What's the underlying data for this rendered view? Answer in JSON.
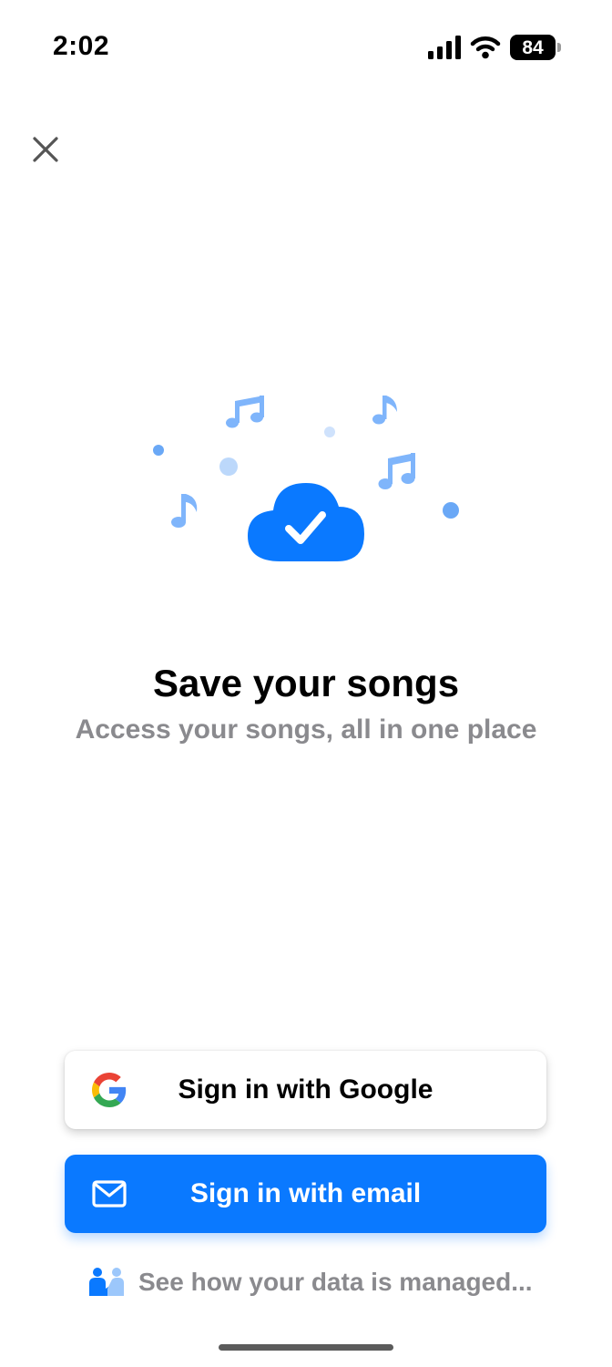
{
  "status_bar": {
    "time": "2:02",
    "battery_level": "84",
    "icons": [
      "signal-icon",
      "wifi-icon",
      "battery-icon"
    ]
  },
  "header": {
    "close_icon": "close-icon"
  },
  "hero": {
    "title": "Save your songs",
    "subtitle": "Access your songs, all in one place",
    "illustration_icon": "cloud-check-icon"
  },
  "actions": {
    "google_button_label": "Sign in with Google",
    "email_button_label": "Sign in with email",
    "data_link_text": "See how your data is managed..."
  },
  "colors": {
    "accent": "#0a79ff",
    "light_accent": "#7fb5fb",
    "muted_text": "#8a8a8e"
  }
}
